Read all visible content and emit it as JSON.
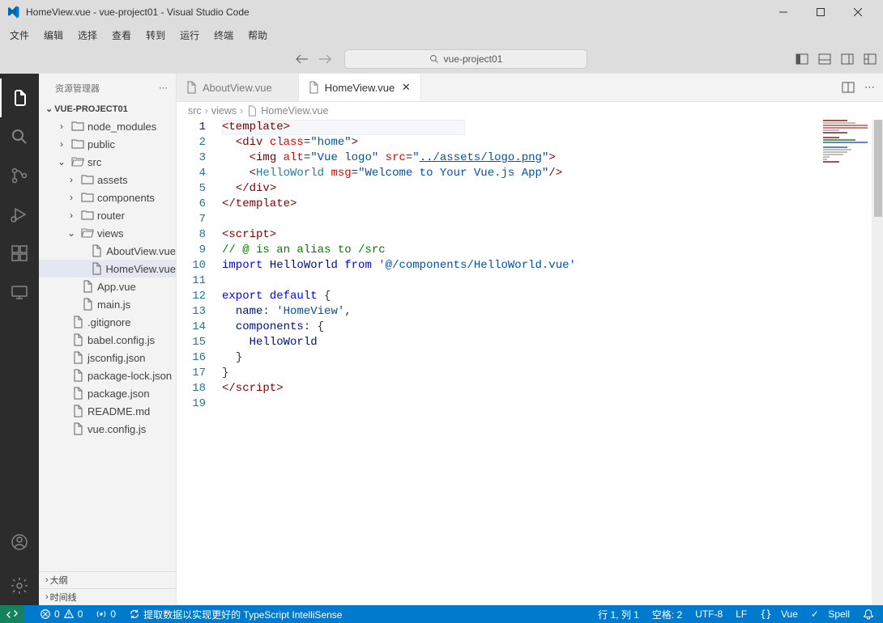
{
  "window": {
    "title": "HomeView.vue - vue-project01 - Visual Studio Code"
  },
  "menu": [
    "文件",
    "编辑",
    "选择",
    "查看",
    "转到",
    "运行",
    "终端",
    "帮助"
  ],
  "command_center": {
    "search_text": "vue-project01"
  },
  "sidebar": {
    "title": "资源管理器",
    "project_name": "VUE-PROJECT01",
    "outline": "大纲",
    "timeline": "时间线",
    "tree": [
      {
        "name": "node_modules",
        "type": "folder",
        "depth": 1,
        "expanded": false
      },
      {
        "name": "public",
        "type": "folder",
        "depth": 1,
        "expanded": false
      },
      {
        "name": "src",
        "type": "folder",
        "depth": 1,
        "expanded": true
      },
      {
        "name": "assets",
        "type": "folder",
        "depth": 2,
        "expanded": false
      },
      {
        "name": "components",
        "type": "folder",
        "depth": 2,
        "expanded": false
      },
      {
        "name": "router",
        "type": "folder",
        "depth": 2,
        "expanded": false
      },
      {
        "name": "views",
        "type": "folder",
        "depth": 2,
        "expanded": true
      },
      {
        "name": "AboutView.vue",
        "type": "file",
        "depth": 3,
        "selected": false
      },
      {
        "name": "HomeView.vue",
        "type": "file",
        "depth": 3,
        "selected": true
      },
      {
        "name": "App.vue",
        "type": "file",
        "depth": 2
      },
      {
        "name": "main.js",
        "type": "file",
        "depth": 2
      },
      {
        "name": ".gitignore",
        "type": "file",
        "depth": 1
      },
      {
        "name": "babel.config.js",
        "type": "file",
        "depth": 1
      },
      {
        "name": "jsconfig.json",
        "type": "file",
        "depth": 1
      },
      {
        "name": "package-lock.json",
        "type": "file",
        "depth": 1
      },
      {
        "name": "package.json",
        "type": "file",
        "depth": 1
      },
      {
        "name": "README.md",
        "type": "file",
        "depth": 1
      },
      {
        "name": "vue.config.js",
        "type": "file",
        "depth": 1
      }
    ]
  },
  "tabs": [
    {
      "label": "AboutView.vue",
      "active": false
    },
    {
      "label": "HomeView.vue",
      "active": true
    }
  ],
  "breadcrumbs": [
    "src",
    "views",
    "HomeView.vue"
  ],
  "statusbar": {
    "errors": "0",
    "warnings": "0",
    "ports": "0",
    "ts_hint": "提取数据以实现更好的 TypeScript IntelliSense",
    "line_col": "行 1, 列 1",
    "spaces": "空格: 2",
    "encoding": "UTF-8",
    "eol": "LF",
    "language": "Vue",
    "spell": "Spell"
  },
  "code": {
    "lines": 19
  }
}
